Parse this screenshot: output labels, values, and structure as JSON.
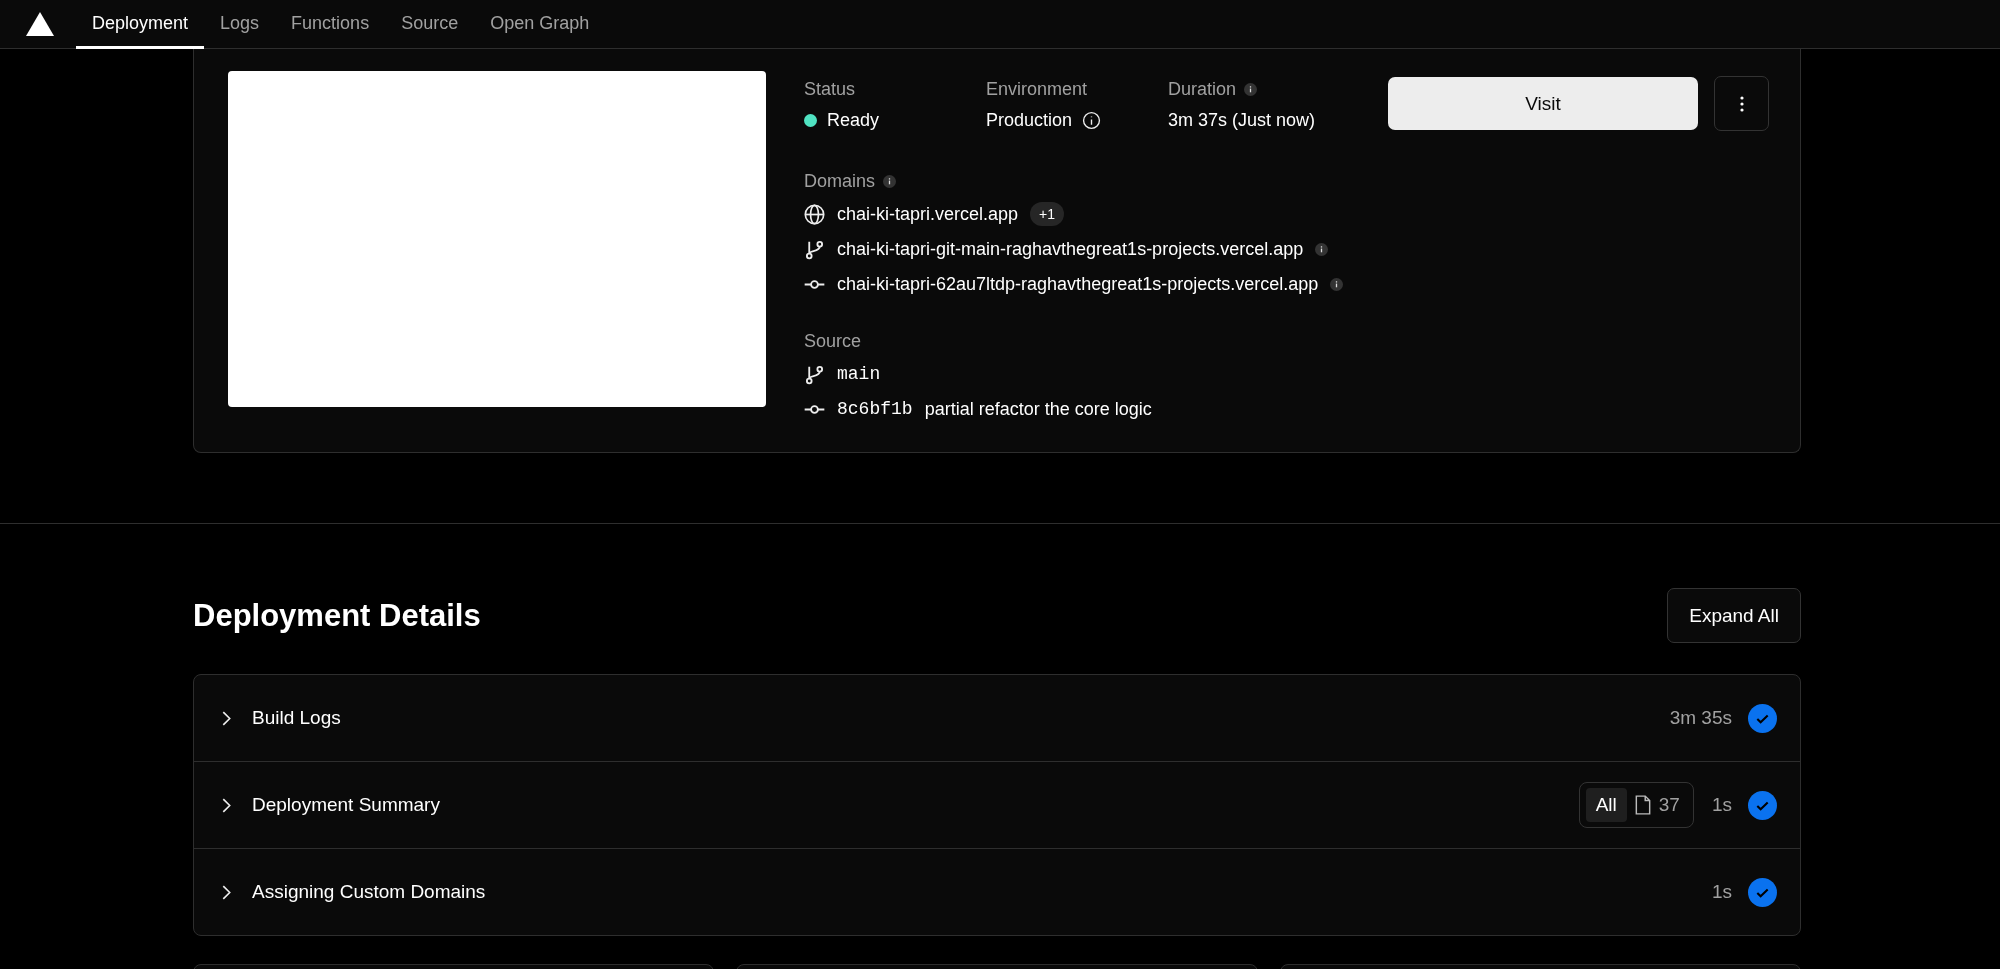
{
  "nav": {
    "tabs": [
      {
        "label": "Deployment",
        "selected": true
      },
      {
        "label": "Logs",
        "selected": false
      },
      {
        "label": "Functions",
        "selected": false
      },
      {
        "label": "Source",
        "selected": false
      },
      {
        "label": "Open Graph",
        "selected": false
      }
    ]
  },
  "deployment": {
    "status": {
      "label": "Status",
      "value": "Ready",
      "ready": true
    },
    "environment": {
      "label": "Environment",
      "value": "Production"
    },
    "duration": {
      "label": "Duration",
      "value": "3m 37s (Just now)"
    },
    "visit_button": "Visit",
    "domains": {
      "label": "Domains",
      "items": [
        {
          "kind": "globe",
          "url": "chai-ki-tapri.vercel.app",
          "badge": "+1",
          "info": false
        },
        {
          "kind": "branch",
          "url": "chai-ki-tapri-git-main-raghavthegreat1s-projects.vercel.app",
          "info": true
        },
        {
          "kind": "commit",
          "url": "chai-ki-tapri-62au7ltdp-raghavthegreat1s-projects.vercel.app",
          "info": true
        }
      ]
    },
    "source": {
      "label": "Source",
      "branch": "main",
      "commit": {
        "hash": "8c6bf1b",
        "message": "partial refactor the core logic"
      }
    }
  },
  "details": {
    "title": "Deployment Details",
    "expand_button": "Expand All",
    "steps": [
      {
        "title": "Build Logs",
        "duration": "3m 35s",
        "completed": true,
        "expanded": false
      },
      {
        "title": "Deployment Summary",
        "duration": "1s",
        "completed": true,
        "expanded": false,
        "filter": {
          "label": "All",
          "count": "37"
        }
      },
      {
        "title": "Assigning Custom Domains",
        "duration": "1s",
        "completed": true,
        "expanded": false
      }
    ]
  }
}
